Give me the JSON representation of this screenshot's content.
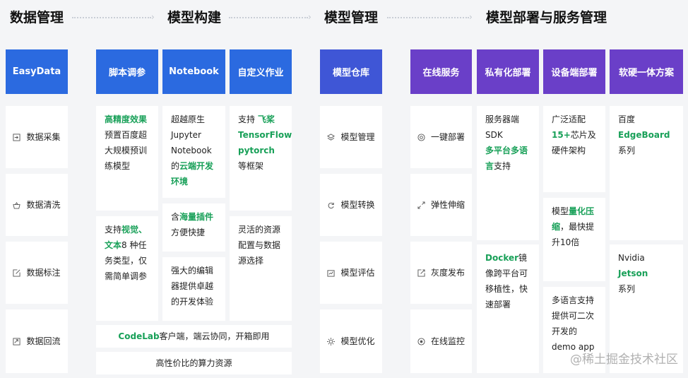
{
  "sections": [
    "数据管理",
    "模型构建",
    "模型管理",
    "模型部署与服务管理"
  ],
  "headers": {
    "easydata": "EasyData",
    "script_tuning": "脚本调参",
    "notebook": "Notebook",
    "custom_job": "自定义作业",
    "model_repo": "模型仓库",
    "online_service": "在线服务",
    "private_deploy": "私有化部署",
    "device_deploy": "设备端部署",
    "hw_sw_solution": "软硬一体方案"
  },
  "data_mgmt": {
    "items": [
      {
        "label": "数据采集",
        "icon": "import-icon"
      },
      {
        "label": "数据清洗",
        "icon": "basket-icon"
      },
      {
        "label": "数据标注",
        "icon": "edit-icon"
      },
      {
        "label": "数据回流",
        "icon": "return-icon"
      }
    ]
  },
  "script_tuning": {
    "card1": {
      "hl": "高精度效果",
      "rest": "预置百度超大规模预训练模型"
    },
    "card2": {
      "pre": "支持",
      "hl1": "视觉、",
      "hl2": "文本",
      "rest": "8 种任务类型，仅需简单调参"
    }
  },
  "notebook": {
    "card1": {
      "pre": "超越原生Jupyter Notebook的",
      "hl": "云端开发环境"
    },
    "card2": {
      "pre": "含",
      "hl": "海量插件",
      "rest": "方便快捷"
    },
    "card3": {
      "text": "强大的编辑器提供卓越的开发体验"
    }
  },
  "custom_job": {
    "card1": {
      "pre": "支持 ",
      "hl1": "飞桨",
      "hl2": "TensorFlow",
      "hl3": "pytorch",
      "rest": "等框架"
    },
    "card2": {
      "text": "灵活的资源配置与数据源选择"
    }
  },
  "codelab": {
    "hl": "CodeLab",
    "rest": "客户端，端云协同，开箱即用"
  },
  "compute": {
    "text": "高性价比的算力资源"
  },
  "model_mgmt": {
    "items": [
      {
        "label": "模型管理",
        "icon": "layers-icon"
      },
      {
        "label": "模型转换",
        "icon": "refresh-icon"
      },
      {
        "label": "模型评估",
        "icon": "chart-icon"
      },
      {
        "label": "模型优化",
        "icon": "sun-icon"
      }
    ]
  },
  "online_service": {
    "items": [
      {
        "label": "一键部署",
        "icon": "at-icon"
      },
      {
        "label": "弹性伸缩",
        "icon": "expand-icon"
      },
      {
        "label": "灰度发布",
        "icon": "publish-icon"
      },
      {
        "label": "在线监控",
        "icon": "monitor-icon"
      }
    ]
  },
  "private_deploy": {
    "card1": {
      "pre": "服务器端SDK",
      "hl": "多平台多语言",
      "rest": "支持"
    },
    "card2": {
      "hl": "Docker",
      "rest": "镜像跨平台可移植性，快速部署"
    }
  },
  "device_deploy": {
    "card1": {
      "pre": "广泛适配",
      "hl": "15+",
      "rest": "芯片及硬件架构"
    },
    "card2": {
      "pre": "模型",
      "hl": "量化压缩",
      "rest": "，最快提升10倍"
    },
    "card3": {
      "text": "多语言支持提供可二次开发的demo app"
    }
  },
  "hw_sw": {
    "card1": {
      "pre": "百度",
      "hl": "EdgeBoard",
      "rest": "系列"
    },
    "card2": {
      "pre": "Nvidia ",
      "hl": "Jetson",
      "rest": "系列"
    }
  },
  "watermark": "@稀土掘金技术社区",
  "colors": {
    "blue": "#2b6ae0",
    "indigo": "#3f56d6",
    "purple": "#6a3fc8",
    "highlight": "#18a058"
  }
}
